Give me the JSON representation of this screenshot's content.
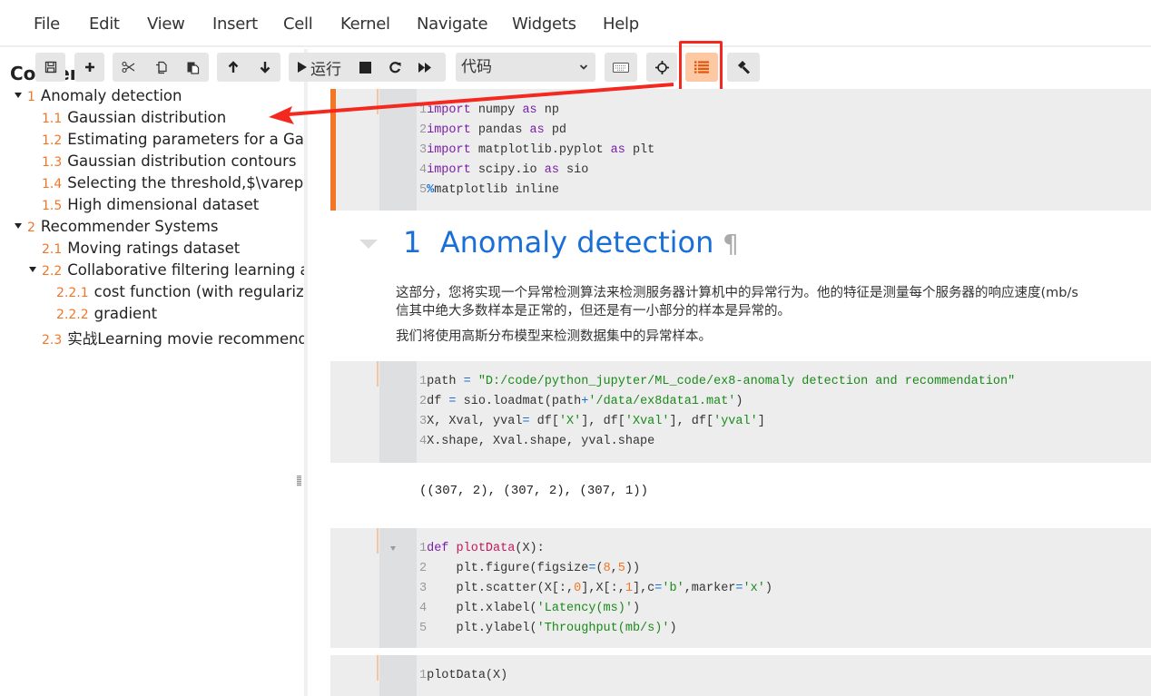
{
  "menubar": {
    "items": [
      "File",
      "Edit",
      "View",
      "Insert",
      "Cell",
      "Kernel",
      "Navigate",
      "Widgets",
      "Help"
    ]
  },
  "toolbar": {
    "save_icon": "save-icon",
    "add_icon": "plus-icon",
    "cut_icon": "scissors-icon",
    "copy_icon": "copy-icon",
    "paste_icon": "paste-icon",
    "move_up_icon": "arrow-up-icon",
    "move_down_icon": "arrow-down-icon",
    "run_label": "运行",
    "cell_type": "代码",
    "accent": "#fdc9a5",
    "annotation_color": "#f5281f"
  },
  "toc": {
    "title": "Contents",
    "items": [
      {
        "num": "1",
        "label": "Anomaly detection"
      },
      {
        "num": "1.1",
        "label": "Gaussian distribution"
      },
      {
        "num": "1.2",
        "label": "Estimating parameters for a Gau"
      },
      {
        "num": "1.3",
        "label": "Gaussian distribution contours"
      },
      {
        "num": "1.4",
        "label": "Selecting the threshold,$\\vareps"
      },
      {
        "num": "1.5",
        "label": "High dimensional dataset"
      },
      {
        "num": "2",
        "label": "Recommender Systems"
      },
      {
        "num": "2.1",
        "label": "Moving ratings dataset"
      },
      {
        "num": "2.2",
        "label": "Collaborative filtering learning a"
      },
      {
        "num": "2.2.1",
        "label": "cost function (with regulariza"
      },
      {
        "num": "2.2.2",
        "label": "gradient"
      },
      {
        "num": "2.3",
        "label": "实战Learning movie recommend"
      }
    ]
  },
  "notebook": {
    "cell1": {
      "lines": [
        {
          "n": "1",
          "kw": "import",
          "rest": " numpy ",
          "kw2": "as",
          "tail": " np"
        },
        {
          "n": "2",
          "kw": "import",
          "rest": " pandas ",
          "kw2": "as",
          "tail": " pd"
        },
        {
          "n": "3",
          "kw": "import",
          "rest": " matplotlib.pyplot ",
          "kw2": "as",
          "tail": " plt"
        },
        {
          "n": "4",
          "kw": "import",
          "rest": " scipy.io ",
          "kw2": "as",
          "tail": " sio"
        },
        {
          "n": "5",
          "magic": "%",
          "tail": "matplotlib inline"
        }
      ]
    },
    "heading": {
      "num": "1",
      "title": "Anomaly detection",
      "pilcrow": "¶"
    },
    "para1_line1": "这部分，您将实现一个异常检测算法来检测服务器计算机中的异常行为。他的特征是测量每个服务器的响应速度(mb/s",
    "para1_line2": "信其中绝大多数样本是正常的，但还是有一小部分的样本是异常的。",
    "para2": "我们将使用高斯分布模型来检测数据集中的异常样本。",
    "cell2": {
      "l1_n": "1",
      "l1_a": "path ",
      "l1_op": "=",
      "l1_str": " \"D:/code/python_jupyter/ML_code/ex8-anomaly detection and recommendation\"",
      "l2_n": "2",
      "l2_a": "df ",
      "l2_op": "=",
      "l2_b": " sio.loadmat(path",
      "l2_op2": "+",
      "l2_str": "'/data/ex8data1.mat'",
      "l2_c": ")",
      "l3_n": "3",
      "l3_a": "X, Xval, yval",
      "l3_op": "=",
      "l3_b": " df[",
      "l3_s1": "'X'",
      "l3_c": "], df[",
      "l3_s2": "'Xval'",
      "l3_d": "], df[",
      "l3_s3": "'yval'",
      "l3_e": "]",
      "l4_n": "4",
      "l4_a": "X.shape, Xval.shape, yval.shape"
    },
    "output2": "((307, 2), (307, 2), (307, 1))",
    "cell3": {
      "l1_n": "1",
      "l1_kw": "def",
      "l1_fn": " plotData",
      "l1_a": "(X):",
      "l2_n": "2",
      "l2_a": "    plt.figure(figsize",
      "l2_op": "=",
      "l2_b": "(",
      "l2_n1": "8",
      "l2_c": ",",
      "l2_n2": "5",
      "l2_d": "))",
      "l3_n": "3",
      "l3_a": "    plt.scatter(X[:,",
      "l3_n1": "0",
      "l3_b": "],X[:,",
      "l3_n2": "1",
      "l3_c": "],c",
      "l3_op": "=",
      "l3_s1": "'b'",
      "l3_d": ",marker",
      "l3_op2": "=",
      "l3_s2": "'x'",
      "l3_e": ")",
      "l4_n": "4",
      "l4_a": "    plt.xlabel(",
      "l4_s": "'Latency(ms)'",
      "l4_b": ")",
      "l5_n": "5",
      "l5_a": "    plt.ylabel(",
      "l5_s": "'Throughput(mb/s)'",
      "l5_b": ")"
    },
    "cell4": {
      "l1_n": "1",
      "l1_a": "plotData(X)"
    }
  }
}
